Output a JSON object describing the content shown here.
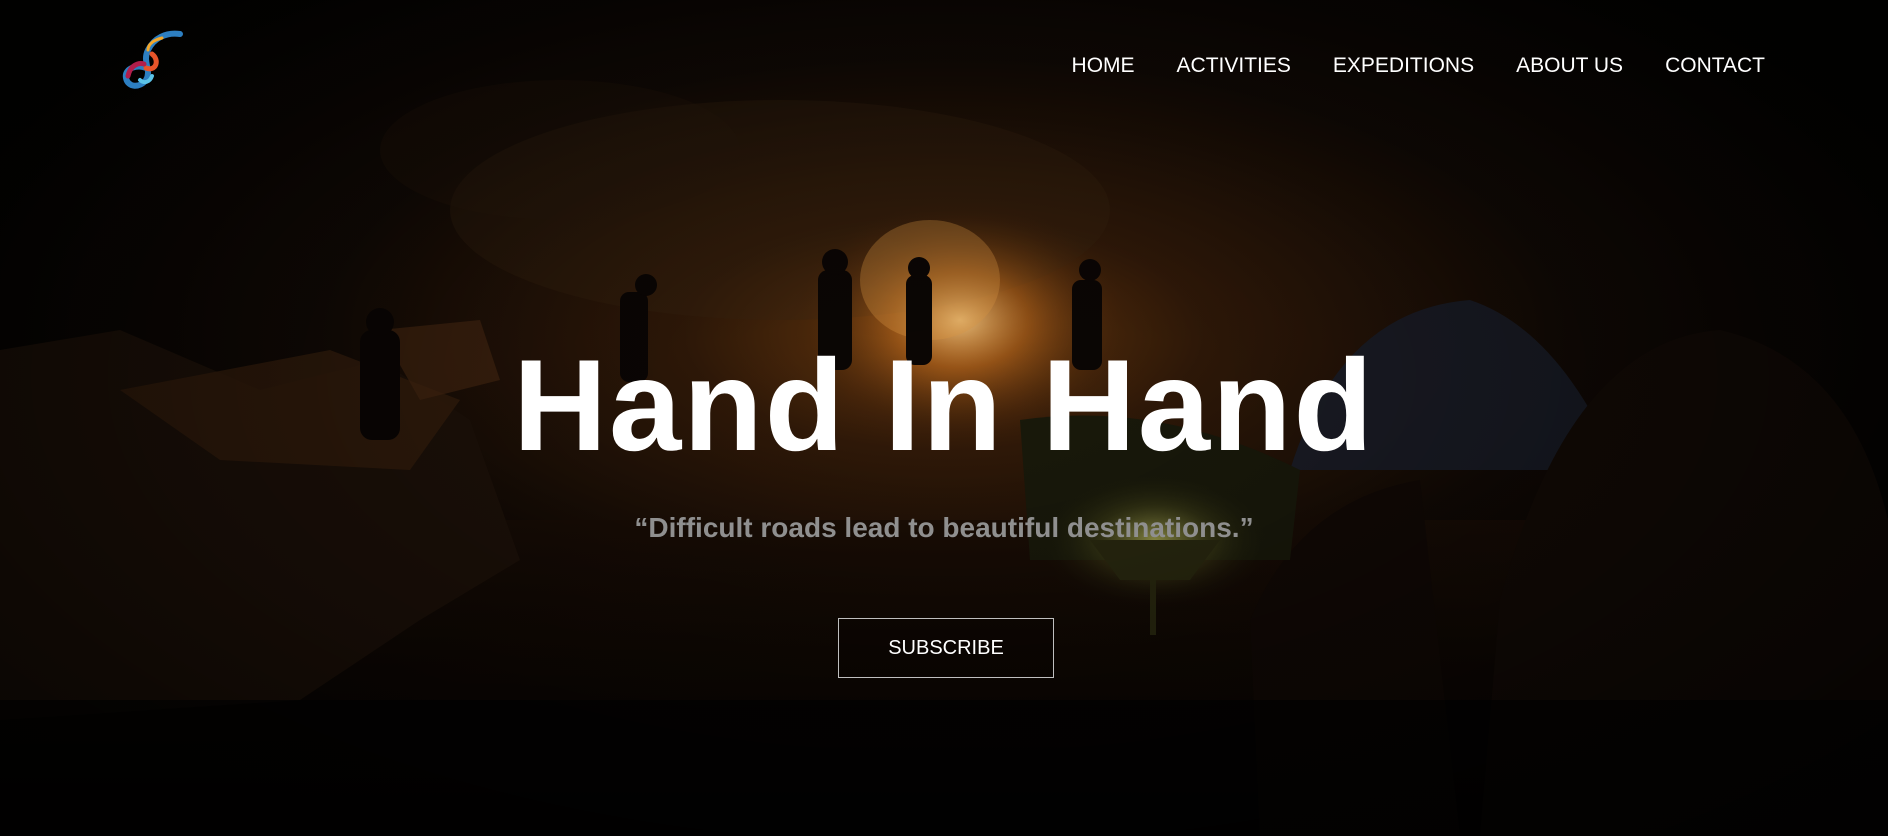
{
  "header": {
    "logo_icon": "brand-swirl-logo-icon",
    "nav": [
      {
        "label": "HOME"
      },
      {
        "label": "ACTIVITIES"
      },
      {
        "label": "EXPEDITIONS"
      },
      {
        "label": "ABOUT US"
      },
      {
        "label": "CONTACT"
      }
    ]
  },
  "hero": {
    "title": "Hand In Hand",
    "quote": "“Difficult roads lead to beautiful destinations.”",
    "cta_label": "SUBSCRIBE",
    "background_icon": "campfire-night-photo"
  },
  "colors": {
    "title": "#ffffff",
    "quote": "#8f8f8f",
    "nav_text": "#ffffff",
    "button_border": "#bfbfbf"
  }
}
